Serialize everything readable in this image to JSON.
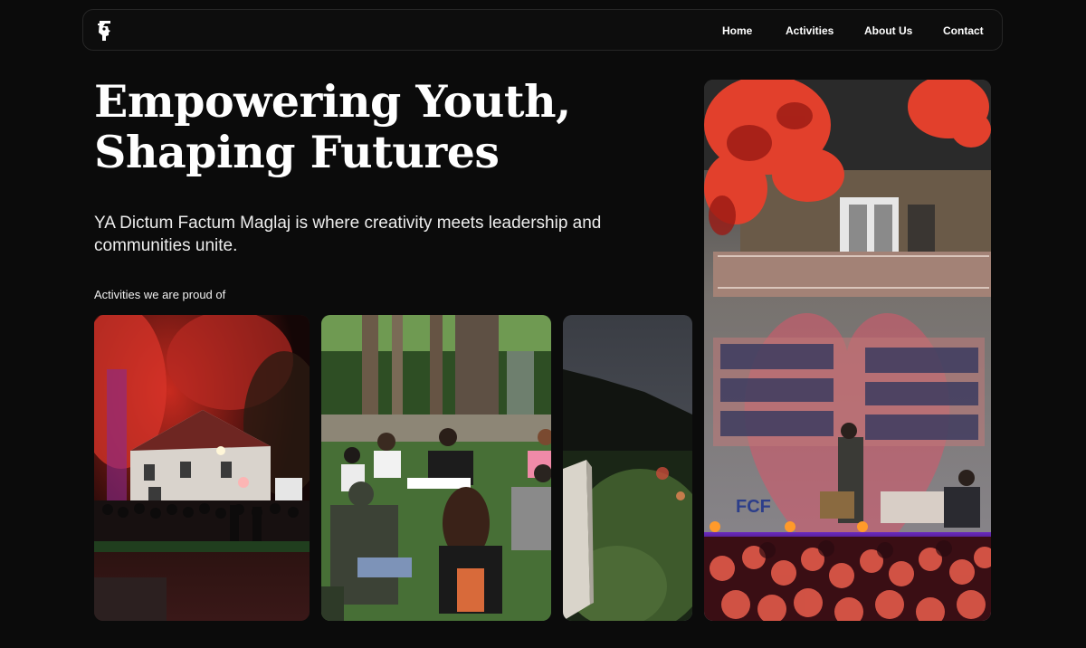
{
  "nav": {
    "logo_icon": "face-profile-logo",
    "links": [
      {
        "label": "Home"
      },
      {
        "label": "Activities"
      },
      {
        "label": "About Us"
      },
      {
        "label": "Contact"
      }
    ]
  },
  "hero": {
    "title_line1": "Empowering Youth,",
    "title_line2": "Shaping Futures",
    "subtitle": "YA Dictum Factum Maglaj is where creativity meets leadership and communities unite."
  },
  "activities": {
    "label": "Activities we are proud of",
    "photos": [
      {
        "alt": "Night outdoor event under red-lit trees"
      },
      {
        "alt": "Group of young people sitting in a circle on grass"
      },
      {
        "alt": "Evening hillside scene with stone monument"
      },
      {
        "alt": "Stage performance in front of building with heart projection"
      }
    ]
  },
  "featured_photo": {
    "sign_text": "FCF"
  },
  "colors": {
    "background": "#0b0b0b",
    "text": "#ffffff",
    "nav_border": "#262626"
  }
}
